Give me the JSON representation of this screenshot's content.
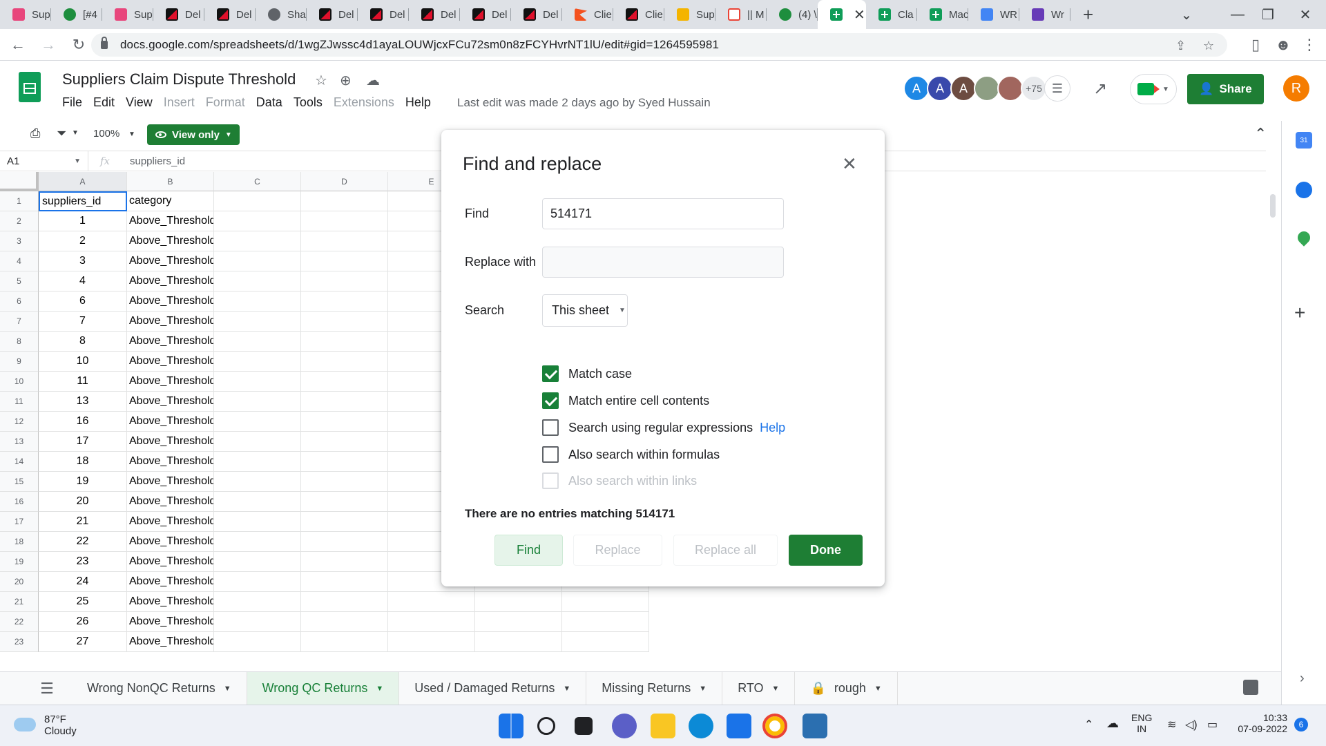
{
  "browser": {
    "tabs": [
      {
        "label": "Sup",
        "icon": "pink"
      },
      {
        "label": "[#4",
        "icon": "round-green"
      },
      {
        "label": "Sup",
        "icon": "pink"
      },
      {
        "label": "Del",
        "icon": "dell"
      },
      {
        "label": "Del",
        "icon": "dell"
      },
      {
        "label": "Sha",
        "icon": "grey"
      },
      {
        "label": "Del",
        "icon": "dell"
      },
      {
        "label": "Del",
        "icon": "dell"
      },
      {
        "label": "Del",
        "icon": "dell"
      },
      {
        "label": "Del",
        "icon": "dell"
      },
      {
        "label": "Del",
        "icon": "dell"
      },
      {
        "label": "Clie",
        "icon": "orange"
      },
      {
        "label": "Clie",
        "icon": "dell"
      },
      {
        "label": "Sup",
        "icon": "yellow"
      },
      {
        "label": "|| M",
        "icon": "gmail"
      },
      {
        "label": "(4) \\",
        "icon": "round-green"
      }
    ],
    "active_tab_close": "✕",
    "tabs_after": [
      {
        "label": "Cla",
        "icon": "green"
      },
      {
        "label": "Mac",
        "icon": "green"
      },
      {
        "label": "WR",
        "icon": "docs"
      },
      {
        "label": "Wr",
        "icon": "purple"
      }
    ],
    "new_tab": "+",
    "url": "docs.google.com/spreadsheets/d/1wgZJwssc4d1ayaLOUWjcxFCu72sm0n8zFCYHvrNT1lU/edit#gid=1264595981"
  },
  "doc": {
    "title": "Suppliers Claim Dispute Threshold",
    "menu": [
      {
        "label": "File",
        "disabled": false
      },
      {
        "label": "Edit",
        "disabled": false
      },
      {
        "label": "View",
        "disabled": false
      },
      {
        "label": "Insert",
        "disabled": true
      },
      {
        "label": "Format",
        "disabled": true
      },
      {
        "label": "Data",
        "disabled": false
      },
      {
        "label": "Tools",
        "disabled": false
      },
      {
        "label": "Extensions",
        "disabled": true
      },
      {
        "label": "Help",
        "disabled": false
      }
    ],
    "last_edit": "Last edit was made 2 days ago by Syed Hussain",
    "collaborators": [
      {
        "initial": "A",
        "color": "#1e88e5"
      },
      {
        "initial": "A",
        "color": "#3949ab"
      },
      {
        "initial": "A",
        "color": "#6d4c41"
      },
      {
        "initial": "",
        "color": "#8d9e83"
      },
      {
        "initial": "",
        "color": "#a1665e"
      }
    ],
    "collaborator_count": "+75",
    "share_label": "Share",
    "user_initial": "R",
    "zoom": "100%",
    "view_only_label": "View only"
  },
  "formula_bar": {
    "cell_ref": "A1",
    "fx": "fx",
    "content": "suppliers_id"
  },
  "sheet": {
    "columns": [
      "A",
      "B",
      "C",
      "D",
      "E"
    ],
    "header_row": [
      "suppliers_id",
      "category"
    ],
    "rows": [
      {
        "n": "2",
        "id": "1",
        "category": "Above_Threshold"
      },
      {
        "n": "3",
        "id": "2",
        "category": "Above_Threshold"
      },
      {
        "n": "4",
        "id": "3",
        "category": "Above_Threshold"
      },
      {
        "n": "5",
        "id": "4",
        "category": "Above_Threshold"
      },
      {
        "n": "6",
        "id": "6",
        "category": "Above_Threshold"
      },
      {
        "n": "7",
        "id": "7",
        "category": "Above_Threshold"
      },
      {
        "n": "8",
        "id": "8",
        "category": "Above_Threshold"
      },
      {
        "n": "9",
        "id": "10",
        "category": "Above_Threshold"
      },
      {
        "n": "10",
        "id": "11",
        "category": "Above_Threshold"
      },
      {
        "n": "11",
        "id": "13",
        "category": "Above_Threshold"
      },
      {
        "n": "12",
        "id": "16",
        "category": "Above_Threshold"
      },
      {
        "n": "13",
        "id": "17",
        "category": "Above_Threshold"
      },
      {
        "n": "14",
        "id": "18",
        "category": "Above_Threshold"
      },
      {
        "n": "15",
        "id": "19",
        "category": "Above_Threshold"
      },
      {
        "n": "16",
        "id": "20",
        "category": "Above_Threshold"
      },
      {
        "n": "17",
        "id": "21",
        "category": "Above_Threshold"
      },
      {
        "n": "18",
        "id": "22",
        "category": "Above_Threshold"
      },
      {
        "n": "19",
        "id": "23",
        "category": "Above_Threshold"
      },
      {
        "n": "20",
        "id": "24",
        "category": "Above_Threshold"
      },
      {
        "n": "21",
        "id": "25",
        "category": "Above_Threshold"
      },
      {
        "n": "22",
        "id": "26",
        "category": "Above_Threshold"
      },
      {
        "n": "23",
        "id": "27",
        "category": "Above_Threshold"
      }
    ]
  },
  "sheet_tabs": [
    {
      "label": "Wrong NonQC Returns",
      "active": false,
      "locked": false
    },
    {
      "label": "Wrong QC Returns",
      "active": true,
      "locked": false
    },
    {
      "label": "Used / Damaged Returns",
      "active": false,
      "locked": false
    },
    {
      "label": "Missing Returns",
      "active": false,
      "locked": false
    },
    {
      "label": "RTO",
      "active": false,
      "locked": false
    },
    {
      "label": "rough",
      "active": false,
      "locked": true
    }
  ],
  "dialog": {
    "title": "Find and replace",
    "find_label": "Find",
    "find_value": "514171",
    "replace_label": "Replace with",
    "replace_value": "",
    "search_label": "Search",
    "search_scope": "This sheet",
    "options": [
      {
        "label": "Match case",
        "checked": true,
        "disabled": false
      },
      {
        "label": "Match entire cell contents",
        "checked": true,
        "disabled": false
      },
      {
        "label": "Search using regular expressions",
        "checked": false,
        "disabled": false,
        "link": "Help"
      },
      {
        "label": "Also search within formulas",
        "checked": false,
        "disabled": false
      },
      {
        "label": "Also search within links",
        "checked": false,
        "disabled": true
      }
    ],
    "status": "There are no entries matching 514171",
    "buttons": {
      "find": "Find",
      "replace": "Replace",
      "replace_all": "Replace all",
      "done": "Done"
    }
  },
  "taskbar": {
    "temperature": "87°F",
    "condition": "Cloudy",
    "lang_top": "ENG",
    "lang_bottom": "IN",
    "time": "10:33",
    "date": "07-09-2022",
    "notifications": "6"
  }
}
